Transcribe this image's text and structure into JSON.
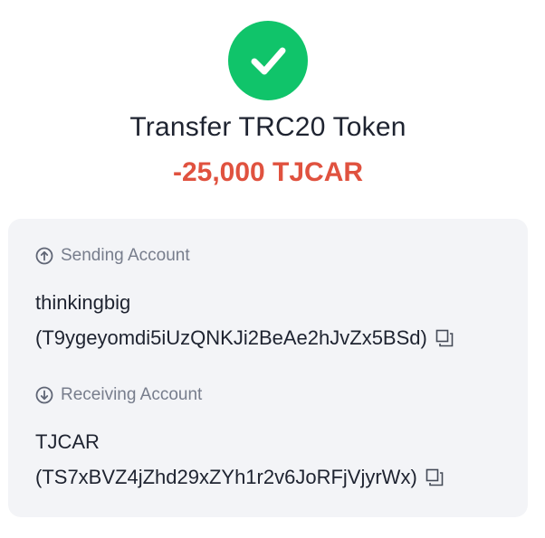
{
  "status": {
    "icon": "check-icon",
    "color": "#10c46a"
  },
  "title": "Transfer TRC20 Token",
  "amount": {
    "text": "-25,000 TJCAR",
    "color": "#e0523f"
  },
  "sending": {
    "label": "Sending Account",
    "icon": "arrow-up-circle-icon",
    "name": "thinkingbig",
    "address": "(T9ygeyomdi5iUzQNKJi2BeAe2hJvZx5BSd)"
  },
  "receiving": {
    "label": "Receiving Account",
    "icon": "arrow-down-circle-icon",
    "name": "TJCAR",
    "address": "(TS7xBVZ4jZhd29xZYh1r2v6JoRFjVjyrWx)"
  }
}
